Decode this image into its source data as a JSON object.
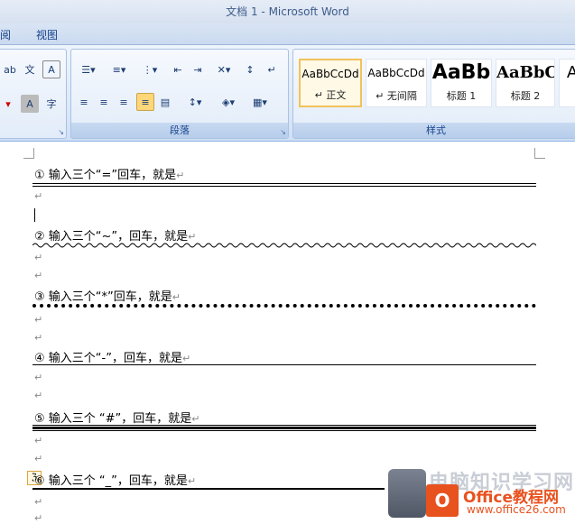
{
  "window": {
    "title": "文档 1 - Microsoft Word"
  },
  "menu": {
    "items": [
      "阅",
      "视图"
    ]
  },
  "ribbon": {
    "groups": {
      "paragraph": "段落",
      "styles": "样式"
    },
    "styles": [
      {
        "sample": "AaBbCcDd",
        "name": "↵ 正文",
        "selected": true
      },
      {
        "sample": "AaBbCcDd",
        "name": "↵ 无间隔",
        "selected": false
      },
      {
        "sample": "AaBb",
        "name": "标题 1",
        "selected": false
      },
      {
        "sample": "AaBbC",
        "name": "标题 2",
        "selected": false
      },
      {
        "sample": "A",
        "name": "",
        "selected": false
      }
    ]
  },
  "document": {
    "lines": [
      {
        "text": "① 输入三个“=”回车，就是",
        "rule": "double"
      },
      {
        "text": "② 输入三个“~”，回车，就是",
        "rule": "wavy"
      },
      {
        "text": "③ 输入三个“*”回车，就是",
        "rule": "dotted"
      },
      {
        "text": "④ 输入三个“-”，回车，就是",
        "rule": "thin"
      },
      {
        "text": "⑤ 输入三个 “#”，回车，就是",
        "rule": "triple"
      },
      {
        "text": "⑥ 输入三个 “_”，回车，就是",
        "rule": "thick"
      }
    ],
    "paragraph_mark": "↵"
  },
  "watermark": {
    "title": "电脑知识学习网",
    "brand": "Office教程网",
    "url": "www.office26.com"
  },
  "colors": {
    "title_text": "#3e5c8a",
    "ribbon_text": "#15428b",
    "accent": "#e8521e"
  }
}
